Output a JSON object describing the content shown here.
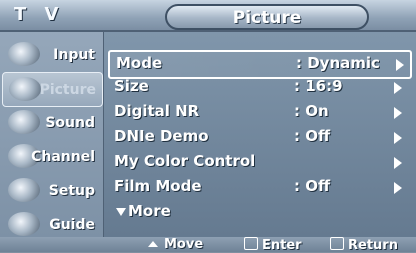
{
  "window": {
    "top_label": "T V",
    "title": "Picture"
  },
  "sidebar": {
    "items": [
      {
        "label": "Input",
        "icon": "input-plug-icon"
      },
      {
        "label": "Picture",
        "icon": "picture-icon",
        "active": true
      },
      {
        "label": "Sound",
        "icon": "sound-speaker-icon"
      },
      {
        "label": "Channel",
        "icon": "channel-antenna-icon"
      },
      {
        "label": "Setup",
        "icon": "setup-gear-icon"
      },
      {
        "label": "Guide",
        "icon": "guide-icon"
      }
    ]
  },
  "menu": {
    "rows": [
      {
        "name": "Mode",
        "value": ": Dynamic",
        "has_arrow": true,
        "selected": true
      },
      {
        "name": "Size",
        "value": ": 16:9",
        "has_arrow": true
      },
      {
        "name": "Digital NR",
        "value": ": On",
        "has_arrow": true
      },
      {
        "name": "DNIe Demo",
        "value": ": Off",
        "has_arrow": true
      },
      {
        "name": "My Color Control",
        "value": "",
        "has_arrow": true
      },
      {
        "name": "Film Mode",
        "value": ": Off",
        "has_arrow": true
      }
    ],
    "more_label": "More"
  },
  "bottom": {
    "move": "Move",
    "enter": "Enter",
    "return": "Return"
  },
  "colors": {
    "accent": "#6f8296",
    "text": "#ffffff"
  }
}
